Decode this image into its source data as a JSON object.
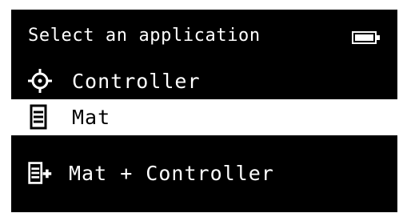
{
  "header": {
    "title": "Select an application",
    "battery_icon": "battery-icon"
  },
  "menu": {
    "items": [
      {
        "label": "Controller",
        "icon": "crosshair-icon",
        "selected": false
      },
      {
        "label": "Mat",
        "icon": "mat-icon",
        "selected": true
      },
      {
        "label": "Mat + Controller",
        "icon": "mat-plus-icon",
        "selected": false
      }
    ]
  },
  "colors": {
    "background": "#000000",
    "foreground": "#ffffff",
    "selected_background": "#ffffff",
    "selected_foreground": "#000000"
  }
}
